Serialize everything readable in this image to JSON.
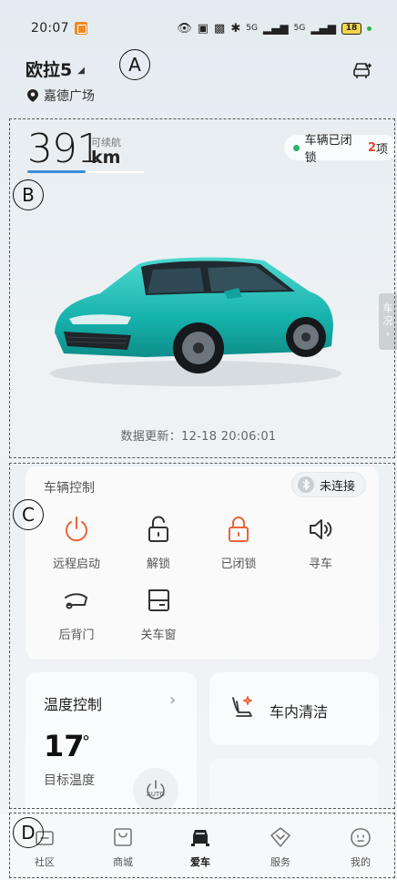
{
  "status_bar": {
    "time": "20:07",
    "network_5g_1": "5G",
    "network_5g_2": "5G",
    "battery": "18"
  },
  "header": {
    "car_name": "欧拉5",
    "location": "嘉德广场"
  },
  "markers": {
    "a": "A",
    "b": "B",
    "c": "C",
    "d": "D"
  },
  "vehicle": {
    "range_value": "391",
    "range_caption": "可续航",
    "range_unit": "km",
    "range_fraction": 0.5,
    "lock_status": "车辆已闭锁",
    "lock_issue_count": "2",
    "lock_issue_suffix": "项",
    "side_tab_char1": "车",
    "side_tab_char2": "况",
    "update_time": "数据更新：12-18 20:06:01"
  },
  "vehicle_control": {
    "title": "车辆控制",
    "bluetooth_status": "未连接",
    "controls": [
      {
        "label": "远程启动",
        "icon": "power-icon"
      },
      {
        "label": "解锁",
        "icon": "unlock-icon"
      },
      {
        "label": "已闭锁",
        "icon": "lock-icon"
      },
      {
        "label": "寻车",
        "icon": "speaker-icon"
      },
      {
        "label": "后背门",
        "icon": "tailgate-icon"
      },
      {
        "label": "关车窗",
        "icon": "window-icon"
      }
    ]
  },
  "temperature": {
    "title": "温度控制",
    "value": "17",
    "unit": "°",
    "label": "目标温度",
    "auto_label": "AUTO"
  },
  "cleaning": {
    "label": "车内清洁"
  },
  "bottom_nav": [
    {
      "label": "社区"
    },
    {
      "label": "商城"
    },
    {
      "label": "爱车"
    },
    {
      "label": "服务"
    },
    {
      "label": "我的"
    }
  ],
  "colors": {
    "accent_orange": "#e8663b",
    "range_bar": "#3b8fd8",
    "lock_ok": "#2bb36a",
    "car_teal": "#1fbfb8"
  }
}
